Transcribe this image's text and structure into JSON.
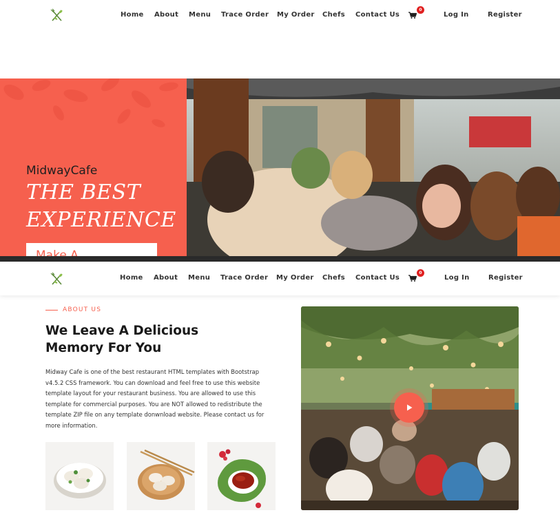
{
  "nav": {
    "logo_icon": "fork-knife-leaf-icon",
    "links": [
      "Home",
      "About",
      "Menu",
      "Trace Order",
      "My Order",
      "Chefs",
      "Contact Us"
    ],
    "cart_count": "0",
    "login": "Log In",
    "register": "Register"
  },
  "hero": {
    "brand": "MidwayCafe",
    "title_line1": "THE BEST",
    "title_line2": "EXPERIENCE",
    "button": "Make A"
  },
  "about": {
    "eyebrow": "ABOUT US",
    "heading_line1": "We Leave A Delicious",
    "heading_line2": "Memory For You",
    "body": "Midway Cafe is one of the best restaurant HTML templates with Bootstrap v4.5.2 CSS framework. You can download and feel free to use this website template layout for your restaurant business. You are allowed to use this template for commercial purposes. You are NOT allowed to redistribute the template ZIP file on any template donwnload website. Please contact us for more information.",
    "thumbnails": [
      "dumplings-bowl",
      "dumplings-plate-chopsticks",
      "tea-cup-leaf"
    ],
    "play_icon": "play-icon"
  },
  "colors": {
    "accent": "#f6604e",
    "badge": "#e02020",
    "text_dark": "#1a1a1a"
  }
}
